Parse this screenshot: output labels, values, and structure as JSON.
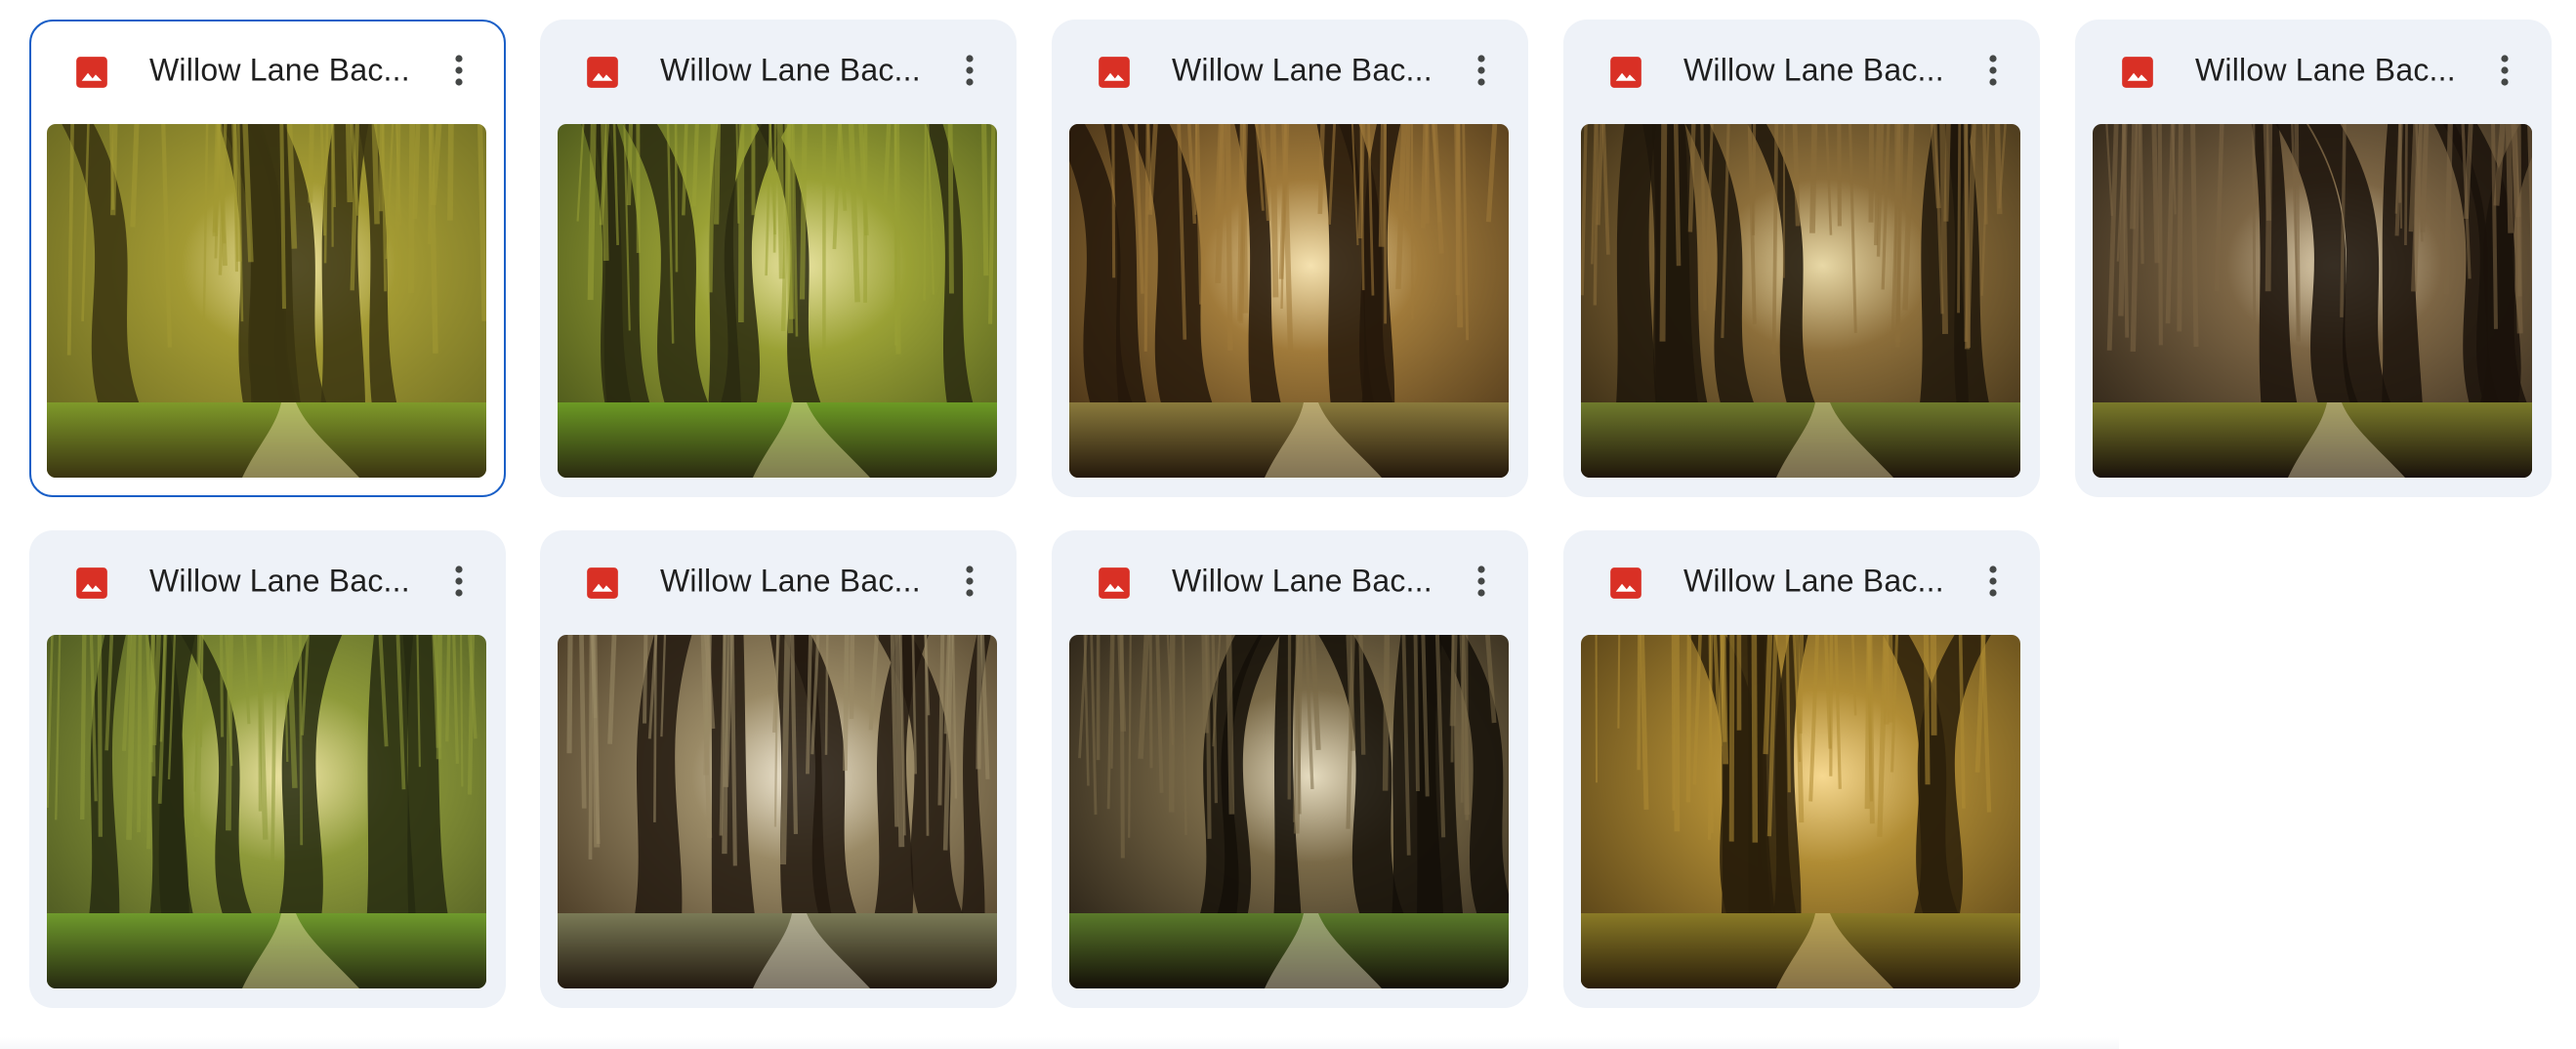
{
  "files": [
    {
      "name": "Willow Lane Bac...",
      "icon": "image-file-icon",
      "selected": true,
      "palette": [
        "#6b6a22",
        "#a39a33",
        "#3a3410",
        "#7f9a2a",
        "#f2e7a6"
      ]
    },
    {
      "name": "Willow Lane Bac...",
      "icon": "image-file-icon",
      "selected": false,
      "palette": [
        "#4e5a1c",
        "#9aa135",
        "#2a2a10",
        "#6c9a24",
        "#e9e3a0"
      ]
    },
    {
      "name": "Willow Lane Bac...",
      "icon": "image-file-icon",
      "selected": false,
      "palette": [
        "#4a3418",
        "#a07a3a",
        "#24180b",
        "#8a7a3c",
        "#f5e2b0"
      ]
    },
    {
      "name": "Willow Lane Bac...",
      "icon": "image-file-icon",
      "selected": false,
      "palette": [
        "#3c2e16",
        "#8c6e3a",
        "#1f160a",
        "#6f7a2c",
        "#e8d8a6"
      ]
    },
    {
      "name": "Willow Lane Bac...",
      "icon": "image-file-icon",
      "selected": false,
      "palette": [
        "#33281a",
        "#7c6544",
        "#1a120a",
        "#7a7a2a",
        "#dfd0b0"
      ]
    },
    {
      "name": "Willow Lane Bac...",
      "icon": "image-file-icon",
      "selected": false,
      "palette": [
        "#4e5a22",
        "#8e9a3a",
        "#262a10",
        "#6f9a2c",
        "#f0e6a6"
      ]
    },
    {
      "name": "Willow Lane Bac...",
      "icon": "image-file-icon",
      "selected": false,
      "palette": [
        "#4b3c26",
        "#9a8a66",
        "#22190f",
        "#7a7a56",
        "#f2ead6"
      ]
    },
    {
      "name": "Willow Lane Bac...",
      "icon": "image-file-icon",
      "selected": false,
      "palette": [
        "#2c2418",
        "#7a6a48",
        "#140f08",
        "#5a7a2a",
        "#e6dcc0"
      ]
    },
    {
      "name": "Willow Lane Bac...",
      "icon": "image-file-icon",
      "selected": false,
      "palette": [
        "#5a4418",
        "#b08c34",
        "#2a1e0a",
        "#8a7a26",
        "#f6d890"
      ]
    }
  ],
  "more_actions_icon": "more-vert-icon",
  "colors": {
    "accent": "#1a5fc7",
    "card_bg": "#eef2f8",
    "icon_red": "#d93025"
  }
}
